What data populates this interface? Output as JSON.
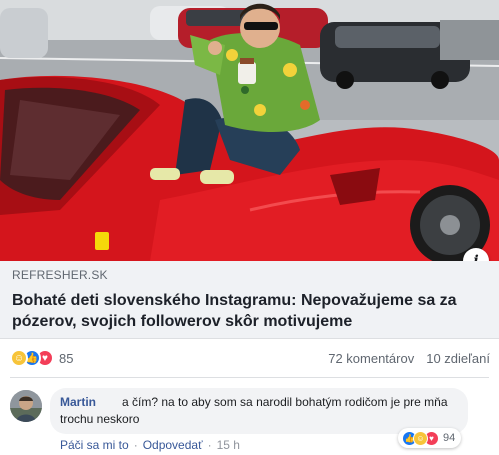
{
  "link_preview": {
    "domain": "REFRESHER.SK",
    "headline": "Bohaté deti slovenského Instagramu: Nepovažujeme sa za pózerov, svojich followerov skôr motivujeme",
    "image_alt": "Young man in sunglasses and floral shirt sitting on a red sports car",
    "info_icon": "i"
  },
  "reactions": {
    "icons": [
      "haha-icon",
      "like-icon",
      "love-icon"
    ],
    "count": "85",
    "comments": "72 komentárov",
    "shares": "10 zdieľaní"
  },
  "comment": {
    "author": "Martin",
    "text": "a čím? na to aby som sa narodil bohatým rodičom je pre mňa trochu neskoro",
    "like_action": "Páči sa mi to",
    "reply_action": "Odpovedať",
    "time": "15 h",
    "reaction_icons": [
      "like-icon",
      "haha-icon",
      "love-icon"
    ],
    "reaction_count": "94"
  },
  "colors": {
    "link_blue": "#385898",
    "car_red": "#d4151c",
    "like_blue": "#1877f2",
    "love_red": "#f33e58",
    "haha_yellow": "#f7c43a"
  }
}
